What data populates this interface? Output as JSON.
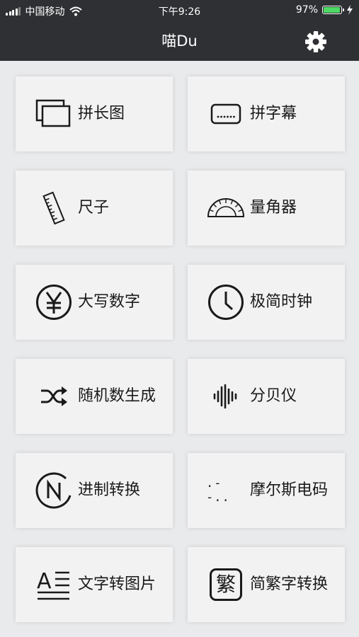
{
  "status_bar": {
    "carrier": "中国移动",
    "time": "下午9:26",
    "battery": "97%",
    "battery_level": 0.97,
    "wifi_icon": "wifi-icon",
    "charging_icon": "bolt-icon"
  },
  "nav": {
    "title": "喵Du",
    "settings_icon": "gear-icon"
  },
  "tools": [
    {
      "label": "拼长图",
      "icon": "stacked-images-icon"
    },
    {
      "label": "拼字幕",
      "icon": "subtitle-icon"
    },
    {
      "label": "尺子",
      "icon": "ruler-icon"
    },
    {
      "label": "量角器",
      "icon": "protractor-icon"
    },
    {
      "label": "大写数字",
      "icon": "yuan-icon"
    },
    {
      "label": "极简时钟",
      "icon": "clock-icon"
    },
    {
      "label": "随机数生成",
      "icon": "shuffle-icon"
    },
    {
      "label": "分贝仪",
      "icon": "sound-wave-icon"
    },
    {
      "label": "进制转换",
      "icon": "base-convert-icon"
    },
    {
      "label": "摩尔斯电码",
      "icon": "morse-icon"
    },
    {
      "label": "文字转图片",
      "icon": "text-to-image-icon"
    },
    {
      "label": "简繁字转换",
      "icon": "traditional-char-icon"
    }
  ],
  "icon_text": {
    "morse": ".- -..",
    "text_to_image": "A",
    "traditional": "繁"
  },
  "colors": {
    "header": "#2f3033",
    "card": "#f2f2f2",
    "background": "#e9eaec",
    "battery": "#4cd964"
  }
}
